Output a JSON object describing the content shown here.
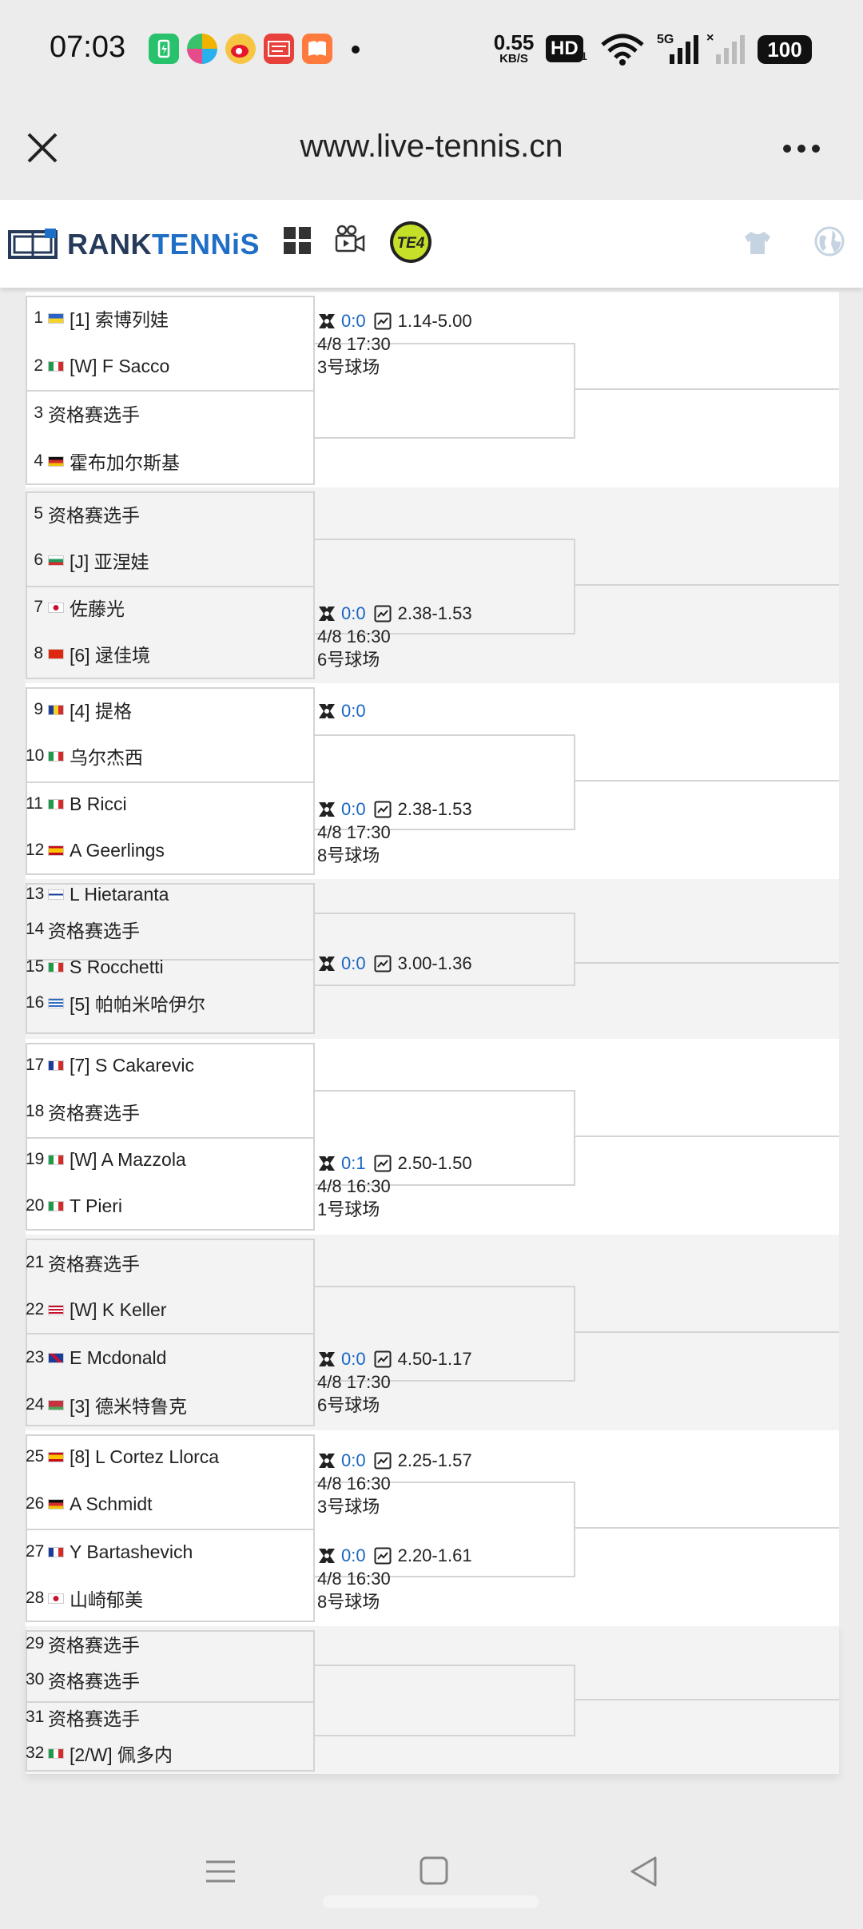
{
  "status_bar": {
    "time": "07:03",
    "net_speed_value": "0.55",
    "net_speed_unit": "KB/S",
    "hd_badge": "HD",
    "hd_sub": "1",
    "battery": "100"
  },
  "browser": {
    "url": "www.live-tennis.cn"
  },
  "site_header": {
    "logo_word1": "RANK",
    "logo_word2": "TENNiS",
    "te4_label": "TE4"
  },
  "colors": {
    "accent": "#1a66c2",
    "band_white": "#ffffff",
    "band_gray": "#f3f3f3",
    "line": "#d4d4d4"
  },
  "bracket": {
    "sections": [
      {
        "players": [
          {
            "seed": "1",
            "flag": "ukraine",
            "name": "[1] 索博列娃"
          },
          {
            "seed": "2",
            "flag": "italy",
            "name": "[W] F Sacco"
          },
          {
            "seed": "3",
            "flag": "",
            "name": "资格赛选手"
          },
          {
            "seed": "4",
            "flag": "germany",
            "name": "霍布加尔斯基"
          }
        ],
        "matches": [
          {
            "score": "0:0",
            "odds": "1.14-5.00",
            "time": "4/8 17:30",
            "court": "3号球场"
          }
        ]
      },
      {
        "players": [
          {
            "seed": "5",
            "flag": "",
            "name": "资格赛选手"
          },
          {
            "seed": "6",
            "flag": "bulgaria",
            "name": "[J] 亚涅娃"
          },
          {
            "seed": "7",
            "flag": "japan",
            "name": "佐藤光"
          },
          {
            "seed": "8",
            "flag": "china",
            "name": "[6] 逯佳境"
          }
        ],
        "matches": [
          {
            "score": "0:0",
            "odds": "2.38-1.53",
            "time": "4/8 16:30",
            "court": "6号球场"
          }
        ]
      },
      {
        "players": [
          {
            "seed": "9",
            "flag": "romania",
            "name": "[4] 提格"
          },
          {
            "seed": "10",
            "flag": "italy",
            "name": "乌尔杰西"
          },
          {
            "seed": "11",
            "flag": "italy",
            "name": "B Ricci"
          },
          {
            "seed": "12",
            "flag": "spain",
            "name": "A Geerlings"
          }
        ],
        "matches": [
          {
            "score": "0:0"
          },
          {
            "score": "0:0",
            "odds": "2.38-1.53",
            "time": "4/8 17:30",
            "court": "8号球场"
          }
        ]
      },
      {
        "players": [
          {
            "seed": "13",
            "flag": "finland",
            "name": "L Hietaranta"
          },
          {
            "seed": "14",
            "flag": "",
            "name": "资格赛选手"
          },
          {
            "seed": "15",
            "flag": "italy",
            "name": "S Rocchetti"
          },
          {
            "seed": "16",
            "flag": "greece",
            "name": "[5] 帕帕米哈伊尔"
          }
        ],
        "matches": [
          {
            "score": "0:0",
            "odds": "3.00-1.36"
          }
        ]
      },
      {
        "players": [
          {
            "seed": "17",
            "flag": "france",
            "name": "[7] S Cakarevic"
          },
          {
            "seed": "18",
            "flag": "",
            "name": "资格赛选手"
          },
          {
            "seed": "19",
            "flag": "italy",
            "name": "[W] A Mazzola"
          },
          {
            "seed": "20",
            "flag": "italy",
            "name": "T Pieri"
          }
        ],
        "matches": [
          {
            "score": "0:1",
            "odds": "2.50-1.50",
            "time": "4/8 16:30",
            "court": "1号球场"
          }
        ]
      },
      {
        "players": [
          {
            "seed": "21",
            "flag": "",
            "name": "资格赛选手"
          },
          {
            "seed": "22",
            "flag": "usa",
            "name": "[W] K Keller"
          },
          {
            "seed": "23",
            "flag": "uk",
            "name": "E Mcdonald"
          },
          {
            "seed": "24",
            "flag": "belarus",
            "name": "[3] 德米特鲁克"
          }
        ],
        "matches": [
          {
            "score": "0:0",
            "odds": "4.50-1.17",
            "time": "4/8 17:30",
            "court": "6号球场"
          }
        ]
      },
      {
        "players": [
          {
            "seed": "25",
            "flag": "spain",
            "name": "[8] L Cortez Llorca"
          },
          {
            "seed": "26",
            "flag": "germany",
            "name": "A Schmidt"
          },
          {
            "seed": "27",
            "flag": "france",
            "name": "Y Bartashevich"
          },
          {
            "seed": "28",
            "flag": "japan",
            "name": "山崎郁美"
          }
        ],
        "matches": [
          {
            "score": "0:0",
            "odds": "2.25-1.57",
            "time": "4/8 16:30",
            "court": "3号球场"
          },
          {
            "score": "0:0",
            "odds": "2.20-1.61",
            "time": "4/8 16:30",
            "court": "8号球场"
          }
        ]
      },
      {
        "players": [
          {
            "seed": "29",
            "flag": "",
            "name": "资格赛选手"
          },
          {
            "seed": "30",
            "flag": "",
            "name": "资格赛选手"
          },
          {
            "seed": "31",
            "flag": "",
            "name": "资格赛选手"
          },
          {
            "seed": "32",
            "flag": "italy",
            "name": "[2/W] 佩多内"
          }
        ],
        "matches": []
      }
    ]
  }
}
